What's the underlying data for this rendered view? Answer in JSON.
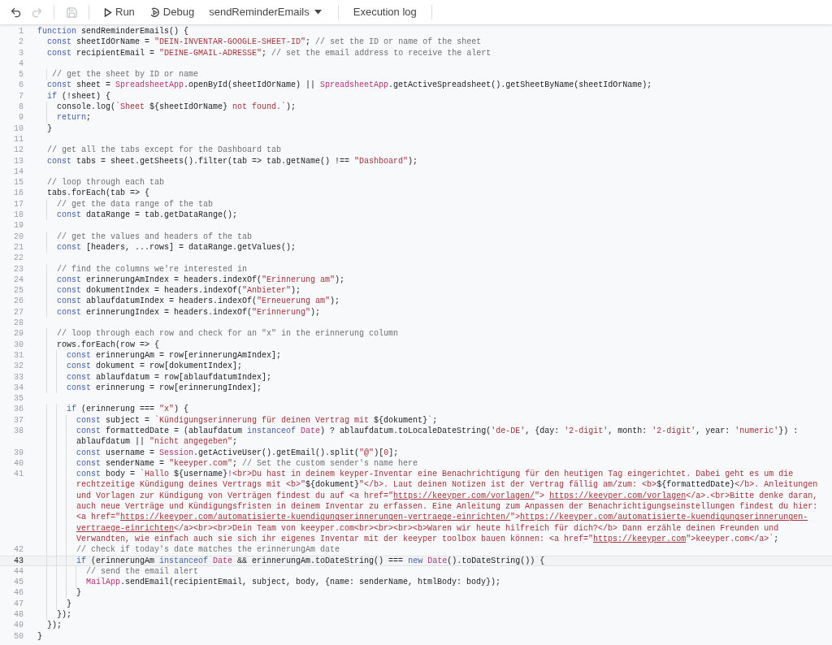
{
  "toolbar": {
    "icon_buttons": [
      {
        "kind": "undo",
        "disabled": false
      },
      {
        "kind": "redo",
        "disabled": true
      },
      {
        "kind": "save",
        "disabled": true
      }
    ],
    "run": "Run",
    "debug": "Debug",
    "function_select": "sendReminderEmails",
    "execution_log": "Execution log"
  },
  "editor": {
    "lines": [
      {
        "number": "1",
        "active": false,
        "segments": [
          {
            "kind": "keyword",
            "text": "function"
          },
          {
            "kind": "plain",
            "text": " sendReminderEmails() {"
          }
        ]
      },
      {
        "number": "2",
        "active": false,
        "segments": [
          {
            "kind": "keyword",
            "text": "  const"
          },
          {
            "kind": "plain",
            "text": " sheetIdOrName = "
          },
          {
            "kind": "string",
            "text": "\"DEIN-INVENTAR-GOOGLE-SHEET-ID\""
          },
          {
            "kind": "plain",
            "text": "; "
          },
          {
            "kind": "comment",
            "text": "// set the ID or name of the sheet"
          }
        ]
      },
      {
        "number": "3",
        "active": false,
        "segments": [
          {
            "kind": "keyword",
            "text": "  const"
          },
          {
            "kind": "plain",
            "text": " recipientEmail = "
          },
          {
            "kind": "string",
            "text": "\"DEINE-GMAIL-ADRESSE\""
          },
          {
            "kind": "plain",
            "text": "; "
          },
          {
            "kind": "comment",
            "text": "// set the email address to receive the alert"
          }
        ]
      },
      {
        "number": "4",
        "active": false
      },
      {
        "number": "5",
        "active": false,
        "segments": [
          {
            "kind": "comment",
            "text": "   // get the sheet by ID or name"
          }
        ]
      },
      {
        "number": "6",
        "active": false,
        "segments": [
          {
            "kind": "keyword",
            "text": "  const"
          },
          {
            "kind": "plain",
            "text": " sheet = "
          },
          {
            "kind": "class",
            "text": "SpreadsheetApp"
          },
          {
            "kind": "plain",
            "text": ".openById(sheetIdOrName) || "
          },
          {
            "kind": "class",
            "text": "SpreadsheetApp"
          },
          {
            "kind": "plain",
            "text": ".getActiveSpreadsheet().getSheetByName(sheetIdOrName);"
          }
        ]
      },
      {
        "number": "7",
        "active": false,
        "segments": [
          {
            "kind": "keyword",
            "text": "  if"
          },
          {
            "kind": "plain",
            "text": " (!sheet) {"
          }
        ]
      },
      {
        "number": "8",
        "active": false,
        "segments": [
          {
            "kind": "plain",
            "text": "    console.log("
          },
          {
            "kind": "string",
            "text": "`Sheet "
          },
          {
            "kind": "plain",
            "text": "${sheetIdOrName}"
          },
          {
            "kind": "string",
            "text": " not found.`"
          },
          {
            "kind": "plain",
            "text": ");"
          }
        ]
      },
      {
        "number": "9",
        "active": false,
        "segments": [
          {
            "kind": "keyword",
            "text": "    return"
          },
          {
            "kind": "plain",
            "text": ";"
          }
        ]
      },
      {
        "number": "10",
        "active": false,
        "segments": [
          {
            "kind": "plain",
            "text": "  }"
          }
        ]
      },
      {
        "number": "11",
        "active": false
      },
      {
        "number": "12",
        "active": false,
        "segments": [
          {
            "kind": "comment",
            "text": "  // get all the tabs except for the Dashboard tab"
          }
        ]
      },
      {
        "number": "13",
        "active": false,
        "segments": [
          {
            "kind": "keyword",
            "text": "  const"
          },
          {
            "kind": "plain",
            "text": " tabs = sheet.getSheets().filter(tab => tab.getName() !== "
          },
          {
            "kind": "string",
            "text": "\"Dashboard\""
          },
          {
            "kind": "plain",
            "text": ");"
          }
        ]
      },
      {
        "number": "14",
        "active": false
      },
      {
        "number": "15",
        "active": false,
        "segments": [
          {
            "kind": "comment",
            "text": "  // loop through each tab"
          }
        ]
      },
      {
        "number": "16",
        "active": false,
        "segments": [
          {
            "kind": "plain",
            "text": "  tabs.forEach(tab => {"
          }
        ]
      },
      {
        "number": "17",
        "active": false,
        "segments": [
          {
            "kind": "comment",
            "text": "    // get the data range of the tab"
          }
        ]
      },
      {
        "number": "18",
        "active": false,
        "segments": [
          {
            "kind": "keyword",
            "text": "    const"
          },
          {
            "kind": "plain",
            "text": " dataRange = tab.getDataRange();"
          }
        ]
      },
      {
        "number": "19",
        "active": false
      },
      {
        "number": "20",
        "active": false,
        "segments": [
          {
            "kind": "comment",
            "text": "    // get the values and headers of the tab"
          }
        ]
      },
      {
        "number": "21",
        "active": false,
        "segments": [
          {
            "kind": "keyword",
            "text": "    const"
          },
          {
            "kind": "plain",
            "text": " [headers, ...rows] = dataRange.getValues();"
          }
        ]
      },
      {
        "number": "22",
        "active": false
      },
      {
        "number": "23",
        "active": false,
        "segments": [
          {
            "kind": "comment",
            "text": "    // find the columns we're interested in"
          }
        ]
      },
      {
        "number": "24",
        "active": false,
        "segments": [
          {
            "kind": "keyword",
            "text": "    const"
          },
          {
            "kind": "plain",
            "text": " erinnerungAmIndex = headers.indexOf("
          },
          {
            "kind": "string",
            "text": "\"Erinnerung am\""
          },
          {
            "kind": "plain",
            "text": ");"
          }
        ]
      },
      {
        "number": "25",
        "active": false,
        "segments": [
          {
            "kind": "keyword",
            "text": "    const"
          },
          {
            "kind": "plain",
            "text": " dokumentIndex = headers.indexOf("
          },
          {
            "kind": "string",
            "text": "\"Anbieter\""
          },
          {
            "kind": "plain",
            "text": ");"
          }
        ]
      },
      {
        "number": "26",
        "active": false,
        "segments": [
          {
            "kind": "keyword",
            "text": "    const"
          },
          {
            "kind": "plain",
            "text": " ablaufdatumIndex = headers.indexOf("
          },
          {
            "kind": "string",
            "text": "\"Erneuerung am\""
          },
          {
            "kind": "plain",
            "text": ");"
          }
        ]
      },
      {
        "number": "27",
        "active": false,
        "segments": [
          {
            "kind": "keyword",
            "text": "    const"
          },
          {
            "kind": "plain",
            "text": " erinnerungIndex = headers.indexOf("
          },
          {
            "kind": "string",
            "text": "\"Erinnerung\""
          },
          {
            "kind": "plain",
            "text": ");"
          }
        ]
      },
      {
        "number": "28",
        "active": false
      },
      {
        "number": "29",
        "active": false,
        "segments": [
          {
            "kind": "comment",
            "text": "    // loop through each row and check for an \"x\" in the erinnerung column"
          }
        ]
      },
      {
        "number": "30",
        "active": false,
        "segments": [
          {
            "kind": "plain",
            "text": "    rows.forEach(row => {"
          }
        ]
      },
      {
        "number": "31",
        "active": false,
        "segments": [
          {
            "kind": "keyword",
            "text": "      const"
          },
          {
            "kind": "plain",
            "text": " erinnerungAm = row[erinnerungAmIndex];"
          }
        ]
      },
      {
        "number": "32",
        "active": false,
        "segments": [
          {
            "kind": "keyword",
            "text": "      const"
          },
          {
            "kind": "plain",
            "text": " dokument = row[dokumentIndex];"
          }
        ]
      },
      {
        "number": "33",
        "active": false,
        "segments": [
          {
            "kind": "keyword",
            "text": "      const"
          },
          {
            "kind": "plain",
            "text": " ablaufdatum = row[ablaufdatumIndex];"
          }
        ]
      },
      {
        "number": "34",
        "active": false,
        "segments": [
          {
            "kind": "keyword",
            "text": "      const"
          },
          {
            "kind": "plain",
            "text": " erinnerung = row[erinnerungIndex];"
          }
        ]
      },
      {
        "number": "35",
        "active": false
      },
      {
        "number": "36",
        "active": false,
        "segments": [
          {
            "kind": "keyword",
            "text": "      if"
          },
          {
            "kind": "plain",
            "text": " (erinnerung === "
          },
          {
            "kind": "string",
            "text": "\"x\""
          },
          {
            "kind": "plain",
            "text": ") {"
          }
        ]
      },
      {
        "number": "37",
        "active": false,
        "segments": [
          {
            "kind": "keyword",
            "text": "        const"
          },
          {
            "kind": "plain",
            "text": " subject = "
          },
          {
            "kind": "string",
            "text": "`Kündigungserinnerung für deinen Vertrag mit "
          },
          {
            "kind": "plain",
            "text": "${dokument}"
          },
          {
            "kind": "string",
            "text": "`"
          },
          {
            "kind": "plain",
            "text": ";"
          }
        ]
      },
      {
        "number": "38",
        "active": false,
        "segments": [
          {
            "kind": "keyword",
            "text": "        const"
          },
          {
            "kind": "plain",
            "text": " formattedDate = (ablaufdatum "
          },
          {
            "kind": "keyword",
            "text": "instanceof"
          },
          {
            "kind": "class",
            "text": " Date"
          },
          {
            "kind": "plain",
            "text": ") ? ablaufdatum.toLocaleDateString("
          },
          {
            "kind": "string",
            "text": "'de-DE'"
          },
          {
            "kind": "plain",
            "text": ", {day: "
          },
          {
            "kind": "string",
            "text": "'2-digit'"
          },
          {
            "kind": "plain",
            "text": ", month: "
          },
          {
            "kind": "string",
            "text": "'2-digit'"
          },
          {
            "kind": "plain",
            "text": ", year: "
          },
          {
            "kind": "string",
            "text": "'numeric'"
          },
          {
            "kind": "plain",
            "text": "}) : ablaufdatum || "
          },
          {
            "kind": "string",
            "text": "\"nicht angegeben\""
          },
          {
            "kind": "plain",
            "text": ";"
          }
        ]
      },
      {
        "number": "39",
        "active": false,
        "segments": [
          {
            "kind": "keyword",
            "text": "        const"
          },
          {
            "kind": "plain",
            "text": " username = "
          },
          {
            "kind": "class",
            "text": "Session"
          },
          {
            "kind": "plain",
            "text": ".getActiveUser().getEmail().split("
          },
          {
            "kind": "string",
            "text": "\"@\""
          },
          {
            "kind": "plain",
            "text": ")["
          },
          {
            "kind": "number",
            "text": "0"
          },
          {
            "kind": "plain",
            "text": "];"
          }
        ]
      },
      {
        "number": "40",
        "active": false,
        "segments": [
          {
            "kind": "keyword",
            "text": "        const"
          },
          {
            "kind": "plain",
            "text": " senderName = "
          },
          {
            "kind": "string",
            "text": "\"keeyper.com\""
          },
          {
            "kind": "plain",
            "text": "; "
          },
          {
            "kind": "comment",
            "text": "// Set the custom sender's name here"
          }
        ]
      },
      {
        "number": "41",
        "active": false,
        "segments": [
          {
            "kind": "keyword",
            "text": "        const"
          },
          {
            "kind": "plain",
            "text": " body = "
          },
          {
            "kind": "string",
            "text": "`Hallo "
          },
          {
            "kind": "plain",
            "text": "${username}"
          },
          {
            "kind": "string",
            "text": "!<br>Du hast in deinem keyper-Inventar eine Benachrichtigung für den heutigen Tag eingerichtet. Dabei geht es um die rechtzeitige Kündigung deines Vertrags mit <b>\""
          },
          {
            "kind": "plain",
            "text": "${dokument}"
          },
          {
            "kind": "string",
            "text": "\"</b>. Laut deinen Notizen ist der Vertrag fällig am/zum: <b>"
          },
          {
            "kind": "plain",
            "text": "${formattedDate}"
          },
          {
            "kind": "string",
            "text": "</b>. Anleitungen und Vorlagen zur Kündigung von Verträgen findest du auf <a href=\""
          },
          {
            "kind": "link",
            "text": "https://keeyper.com/vorlagen/"
          },
          {
            "kind": "string",
            "text": "\"> "
          },
          {
            "kind": "link",
            "text": "https://keeyper.com/vorlagen"
          },
          {
            "kind": "string",
            "text": "</a>.<br>Bitte denke daran, auch neue Verträge und Kündigungsfristen in deinem Inventar zu erfassen. Eine Anleitung zum Anpassen der Benachrichtigungseinstellungen findest du hier: <a href=\""
          },
          {
            "kind": "link",
            "text": "https://keeyper.com/automatisierte-kuendigungserinnerungen-vertraege-einrichten/"
          },
          {
            "kind": "string",
            "text": "\">"
          },
          {
            "kind": "link",
            "text": "https://keeyper.com/automatisierte-kuendigungserinnerungen-vertraege-einrichten"
          },
          {
            "kind": "string",
            "text": "</a><br><br>Dein Team von keeyper.com<br><br><br><b>Waren wir heute hilfreich für dich?</b> Dann erzähle deinen Freunden und Verwandten, wie einfach auch sie sich ihr eigenes Inventar mit der keeyper toolbox bauen können: <a href=\""
          },
          {
            "kind": "link",
            "text": "https://keeyper.com"
          },
          {
            "kind": "string",
            "text": "\">keeyper.com</a>`"
          },
          {
            "kind": "plain",
            "text": ";"
          }
        ]
      },
      {
        "number": "42",
        "active": false,
        "segments": [
          {
            "kind": "comment",
            "text": "        // check if today's date matches the erinnerungAm date"
          }
        ]
      },
      {
        "number": "43",
        "active": true,
        "segments": [
          {
            "kind": "keyword",
            "text": "        if"
          },
          {
            "kind": "plain",
            "text": " (erinnerungAm "
          },
          {
            "kind": "keyword",
            "text": "instanceof"
          },
          {
            "kind": "class",
            "text": " Date"
          },
          {
            "kind": "plain",
            "text": " && erinnerungAm.toDateString() === "
          },
          {
            "kind": "keyword",
            "text": "new"
          },
          {
            "kind": "class",
            "text": " Date"
          },
          {
            "kind": "plain",
            "text": "().toDateString()) {"
          }
        ]
      },
      {
        "number": "44",
        "active": false,
        "segments": [
          {
            "kind": "comment",
            "text": "          // send the email alert"
          }
        ]
      },
      {
        "number": "45",
        "active": false,
        "segments": [
          {
            "kind": "class",
            "text": "          MailApp"
          },
          {
            "kind": "plain",
            "text": ".sendEmail(recipientEmail, subject, body, {name: senderName, htmlBody: body});"
          }
        ]
      },
      {
        "number": "46",
        "active": false,
        "segments": [
          {
            "kind": "plain",
            "text": "        }"
          }
        ]
      },
      {
        "number": "47",
        "active": false,
        "segments": [
          {
            "kind": "plain",
            "text": "      }"
          }
        ]
      },
      {
        "number": "48",
        "active": false,
        "segments": [
          {
            "kind": "plain",
            "text": "    });"
          }
        ]
      },
      {
        "number": "49",
        "active": false,
        "segments": [
          {
            "kind": "plain",
            "text": "  });"
          }
        ]
      },
      {
        "number": "50",
        "active": false,
        "segments": [
          {
            "kind": "plain",
            "text": "}"
          }
        ]
      }
    ]
  }
}
